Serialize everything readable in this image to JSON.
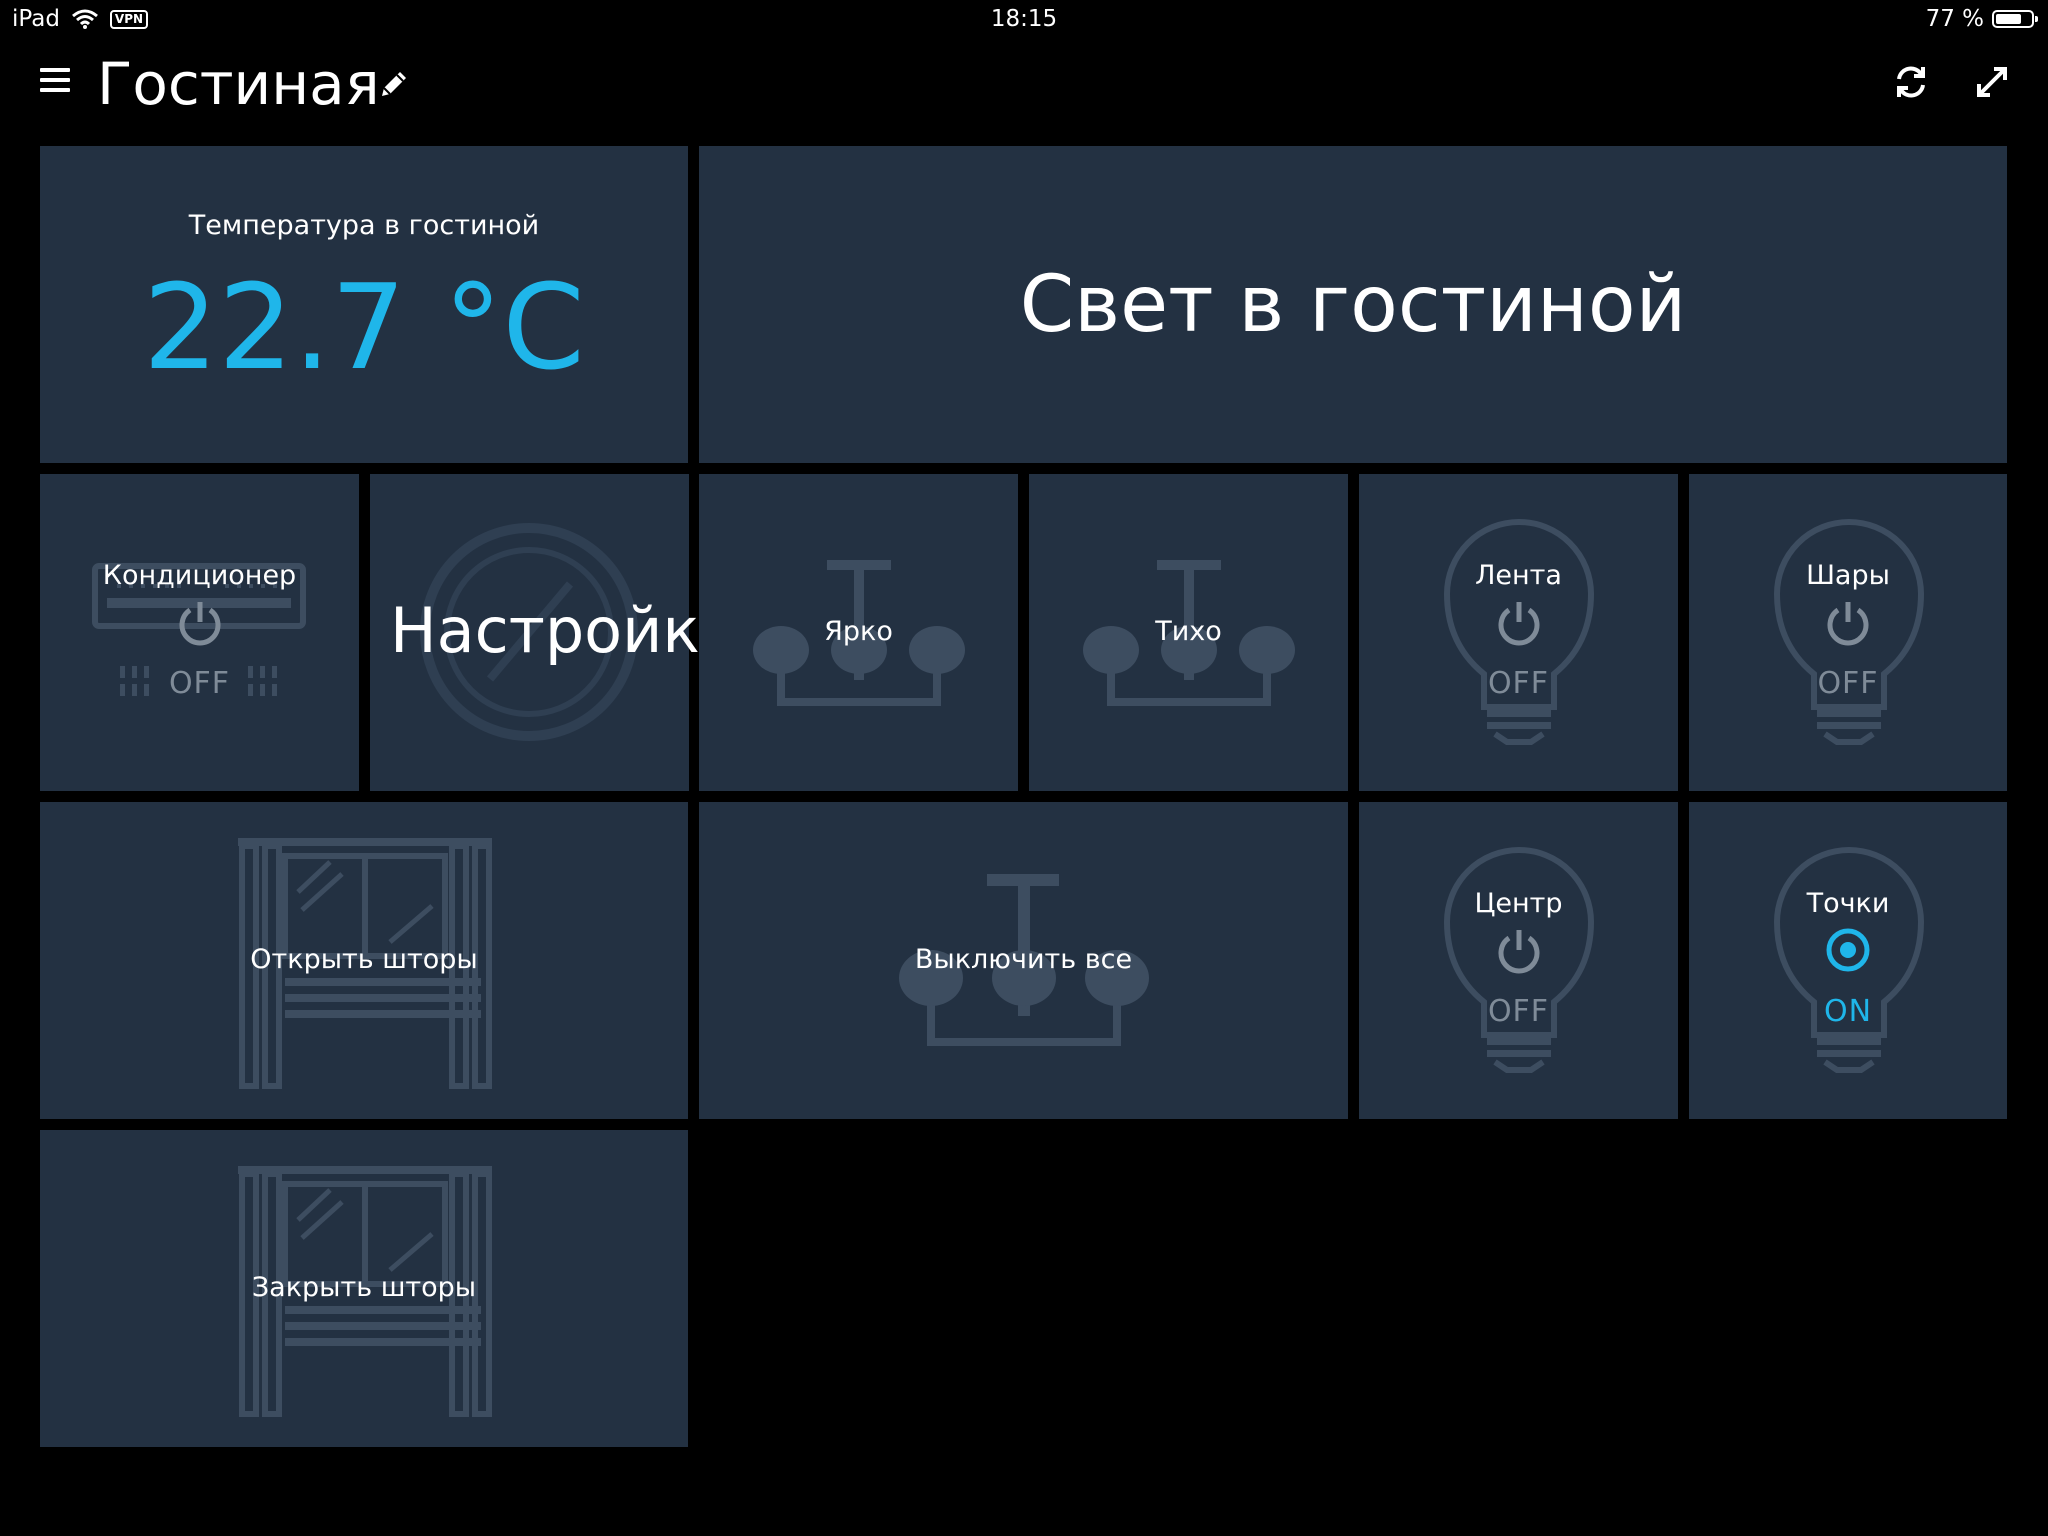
{
  "status_bar": {
    "device": "iPad",
    "vpn": "VPN",
    "time": "18:15",
    "battery": "77 %",
    "battery_level": 0.77
  },
  "header": {
    "title": "Гостиная"
  },
  "tiles": {
    "temperature": {
      "label": "Температура в гостиной",
      "value": "22.7 °C"
    },
    "light_header": {
      "label": "Свет в гостиной"
    },
    "ac": {
      "label": "Кондиционер",
      "state": "OFF"
    },
    "settings": {
      "label": "Настройки"
    },
    "bright": {
      "label": "Ярко"
    },
    "quiet": {
      "label": "Тихо"
    },
    "strip": {
      "label": "Лента",
      "state": "OFF"
    },
    "balls": {
      "label": "Шары",
      "state": "OFF"
    },
    "open_curtains": {
      "label": "Открыть шторы"
    },
    "all_off": {
      "label": "Выключить все"
    },
    "center": {
      "label": "Центр",
      "state": "OFF"
    },
    "spots": {
      "label": "Точки",
      "state": "ON"
    },
    "close_curtains": {
      "label": "Закрыть шторы"
    }
  },
  "colors": {
    "tile_bg": "#233142",
    "accent": "#1fb6ea",
    "off_text": "#7f8b98",
    "icon_faint": "#354659"
  }
}
